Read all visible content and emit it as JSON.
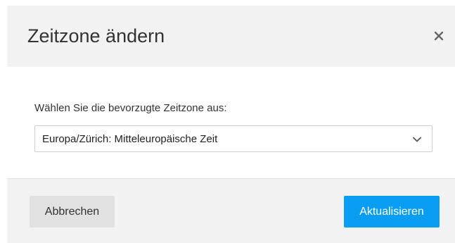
{
  "dialog": {
    "title": "Zeitzone ändern",
    "close_icon": "close-icon",
    "field_label": "Wählen Sie die bevorzugte Zeitzone aus:",
    "timezone_select": {
      "value": "Europa/Zürich: Mitteleuropäische Zeit",
      "icon": "chevron-down-icon"
    },
    "cancel_label": "Abbrechen",
    "update_label": "Aktualisieren"
  },
  "colors": {
    "header_bg": "#f2f2f2",
    "footer_bg": "#f2f2f2",
    "primary": "#0a9ef2",
    "secondary_button": "#e1e1e1"
  }
}
